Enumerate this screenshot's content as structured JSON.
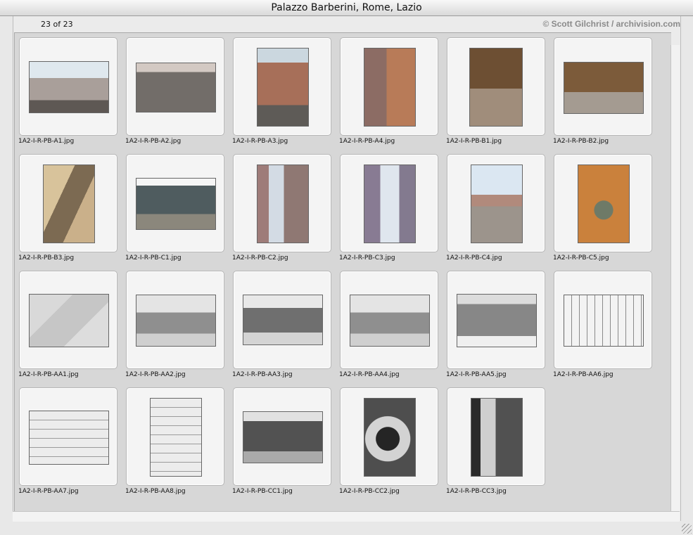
{
  "window": {
    "title": "Palazzo Barberini, Rome, Lazio",
    "count": "23 of 23",
    "credit": "© Scott Gilchrist / archivision.com"
  },
  "thumbnails": [
    "1A2-I-R-PB-A1.jpg",
    "1A2-I-R-PB-A2.jpg",
    "1A2-I-R-PB-A3.jpg",
    "1A2-I-R-PB-A4.jpg",
    "1A2-I-R-PB-B1.jpg",
    "1A2-I-R-PB-B2.jpg",
    "1A2-I-R-PB-B3.jpg",
    "1A2-I-R-PB-C1.jpg",
    "1A2-I-R-PB-C2.jpg",
    "1A2-I-R-PB-C3.jpg",
    "1A2-I-R-PB-C4.jpg",
    "1A2-I-R-PB-C5.jpg",
    "1A2-I-R-PB-AA1.jpg",
    "1A2-I-R-PB-AA2.jpg",
    "1A2-I-R-PB-AA3.jpg",
    "1A2-I-R-PB-AA4.jpg",
    "1A2-I-R-PB-AA5.jpg",
    "1A2-I-R-PB-AA6.jpg",
    "1A2-I-R-PB-AA7.jpg",
    "1A2-I-R-PB-AA8.jpg",
    "1A2-I-R-PB-CC1.jpg",
    "1A2-I-R-PB-CC2.jpg",
    "1A2-I-R-PB-CC3.jpg"
  ]
}
